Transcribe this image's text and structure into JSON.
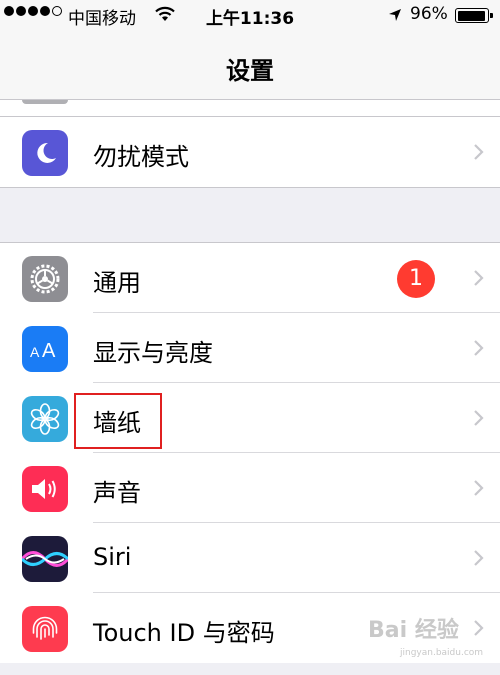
{
  "status_bar": {
    "carrier": "中国移动",
    "time": "上午11:36",
    "battery_percent": "96%",
    "battery_level": 0.96,
    "signal_dots": [
      true,
      true,
      true,
      true,
      false
    ]
  },
  "nav": {
    "title": "设置"
  },
  "group1": [
    {
      "label": "勿扰模式",
      "icon": "moon-icon",
      "color": "#5856d6"
    }
  ],
  "group2": [
    {
      "label": "通用",
      "icon": "gear-icon",
      "color": "#8e8e93",
      "badge": "1"
    },
    {
      "label": "显示与亮度",
      "icon": "text-size-icon",
      "color": "#1a7cf5"
    },
    {
      "label": "墙纸",
      "icon": "flower-icon",
      "color": "#35aadc"
    },
    {
      "label": "声音",
      "icon": "speaker-icon",
      "color": "#fe2d55"
    },
    {
      "label": "Siri",
      "icon": "siri-icon",
      "color": "#1d1b3a"
    },
    {
      "label": "Touch ID 与密码",
      "icon": "fingerprint-icon",
      "color": "#fe3b4f"
    }
  ],
  "watermark": {
    "text": "Bai 经验",
    "sub": "jingyan.baidu.com"
  }
}
